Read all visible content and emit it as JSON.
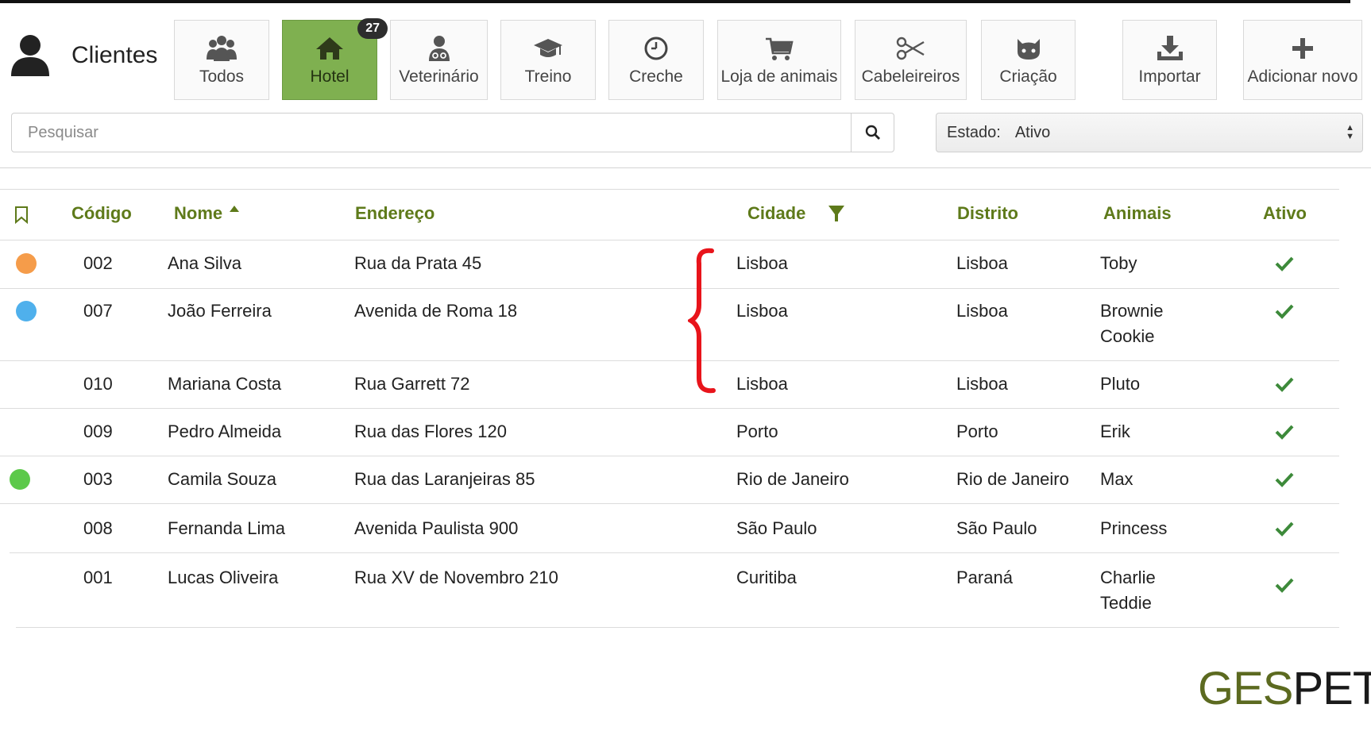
{
  "header": {
    "title": "Clientes"
  },
  "categories": [
    {
      "label": "Todos",
      "icon": "users-icon"
    },
    {
      "label": "Hotel",
      "icon": "home-icon",
      "badge": "27",
      "active": true
    },
    {
      "label": "Veterinário",
      "icon": "doctor-icon"
    },
    {
      "label": "Treino",
      "icon": "graduation-cap-icon"
    },
    {
      "label": "Creche",
      "icon": "clock-icon"
    },
    {
      "label": "Loja de animais",
      "icon": "shopping-cart-icon"
    },
    {
      "label": "Cabeleireiros",
      "icon": "scissors-icon"
    },
    {
      "label": "Criação",
      "icon": "cat-face-icon"
    }
  ],
  "actions": {
    "import_label": "Importar",
    "add_label": "Adicionar novo"
  },
  "search": {
    "placeholder": "Pesquisar"
  },
  "state_filter": {
    "label": "Estado:",
    "value": "Ativo"
  },
  "table": {
    "columns": {
      "codigo": "Código",
      "nome": "Nome",
      "endereco": "Endereço",
      "cidade": "Cidade",
      "distrito": "Distrito",
      "animais": "Animais",
      "ativo": "Ativo"
    },
    "sort": {
      "column": "Nome",
      "direction": "asc"
    },
    "filter_column": "Cidade",
    "rows": [
      {
        "dot": "#f59c4a",
        "codigo": "002",
        "nome": "Ana Silva",
        "endereco": "Rua da Prata 45",
        "cidade": "Lisboa",
        "distrito": "Lisboa",
        "animais": [
          "Toby"
        ],
        "ativo": true
      },
      {
        "dot": "#4fb0ec",
        "codigo": "007",
        "nome": "João Ferreira",
        "endereco": "Avenida de Roma 18",
        "cidade": "Lisboa",
        "distrito": "Lisboa",
        "animais": [
          "Brownie",
          "Cookie"
        ],
        "ativo": true
      },
      {
        "dot": null,
        "codigo": "010",
        "nome": "Mariana Costa",
        "endereco": "Rua Garrett 72",
        "cidade": "Lisboa",
        "distrito": "Lisboa",
        "animais": [
          "Pluto"
        ],
        "ativo": true
      },
      {
        "dot": null,
        "codigo": "009",
        "nome": "Pedro Almeida",
        "endereco": "Rua das Flores 120",
        "cidade": "Porto",
        "distrito": "Porto",
        "animais": [
          "Erik"
        ],
        "ativo": true
      },
      {
        "dot": "#5cc94a",
        "codigo": "003",
        "nome": "Camila Souza",
        "endereco": "Rua das Laranjeiras 85",
        "cidade": "Rio de Janeiro",
        "distrito": "Rio de Janeiro",
        "animais": [
          "Max"
        ],
        "ativo": true
      },
      {
        "dot": null,
        "codigo": "008",
        "nome": "Fernanda Lima",
        "endereco": "Avenida Paulista 900",
        "cidade": "São Paulo",
        "distrito": "São Paulo",
        "animais": [
          "Princess"
        ],
        "ativo": true
      },
      {
        "dot": null,
        "codigo": "001",
        "nome": "Lucas Oliveira",
        "endereco": "Rua XV de Novembro 210",
        "cidade": "Curitiba",
        "distrito": "Paraná",
        "animais": [
          "Charlie",
          "Teddie"
        ],
        "ativo": true
      }
    ]
  },
  "annotation": {
    "color": "#e8141b",
    "shape": "curly-brace"
  },
  "logo": {
    "part1": "GES",
    "part2": "PET",
    "color1": "#5c6a20",
    "color2": "#1a1a1a"
  },
  "colors": {
    "accent": "#7fb050",
    "header_text": "#5e7a1a",
    "check": "#3d8a3a"
  }
}
